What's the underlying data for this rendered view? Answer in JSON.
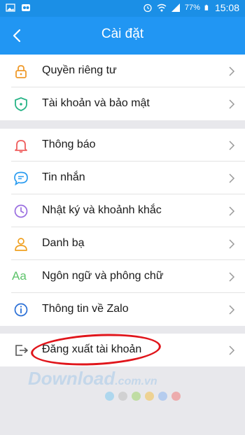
{
  "status": {
    "battery": "77%",
    "time": "15:08"
  },
  "header": {
    "title": "Cài đặt"
  },
  "group1": [
    {
      "label": "Quyền riêng tư",
      "icon": "lock-icon"
    },
    {
      "label": "Tài khoản và bảo mật",
      "icon": "shield-icon"
    }
  ],
  "group2": [
    {
      "label": "Thông báo",
      "icon": "bell-icon"
    },
    {
      "label": "Tin nhắn",
      "icon": "chat-icon"
    },
    {
      "label": "Nhật ký và khoảnh khắc",
      "icon": "clock-icon"
    },
    {
      "label": "Danh bạ",
      "icon": "contact-icon"
    },
    {
      "label": "Ngôn ngữ và phông chữ",
      "icon": "font-icon",
      "icon_text": "Aa"
    },
    {
      "label": "Thông tin về Zalo",
      "icon": "info-icon"
    }
  ],
  "group3": [
    {
      "label": "Đăng xuất tài khoản",
      "icon": "logout-icon"
    }
  ],
  "watermark": {
    "main": "Download",
    "suffix": ".com.vn"
  },
  "colors": {
    "header_bg": "#2196f3",
    "lock": "#ef9a2b",
    "shield": "#28b487",
    "bell": "#ef5e5e",
    "chat": "#2b9cf0",
    "clock": "#9a6ee0",
    "contact": "#f0a020",
    "font": "#5cc36a",
    "info": "#2a6fd6",
    "oval": "#e0151b"
  }
}
